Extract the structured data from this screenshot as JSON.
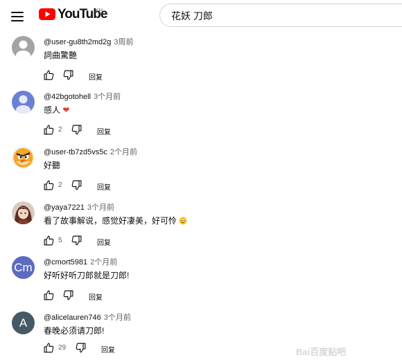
{
  "header": {
    "logo_text": "YouTube",
    "country_code": "KH",
    "search_value": "花妖 刀郎",
    "logo_color": "#ff0000"
  },
  "comments": [
    {
      "author": "@user-gu8th2md2g",
      "time": "3周前",
      "text": "詞曲驚艷",
      "likes": "",
      "avatar": "person-grey"
    },
    {
      "author": "@42bgotohell",
      "time": "3个月前",
      "text": "感人",
      "likes": "2",
      "avatar": "person-blue",
      "emoji": "heart"
    },
    {
      "author": "@user-tb7zd5vs5c",
      "time": "2个月前",
      "text": "好聽",
      "likes": "2",
      "avatar": "angry-bird"
    },
    {
      "author": "@yaya7221",
      "time": "3个月前",
      "text": "看了故事解说，感觉好凄美，好可怜",
      "likes": "5",
      "avatar": "illustration",
      "emoji": "pleading-face"
    },
    {
      "author": "@cmort5981",
      "time": "2个月前",
      "text": "好听好听刀郎就是刀郎!",
      "likes": "",
      "avatar": "letters",
      "avatar_text": "Cm",
      "avatar_color": "#5c6bc0"
    },
    {
      "author": "@alicelauren746",
      "time": "3个月前",
      "text": "春晚必须请刀郎!",
      "likes": "29",
      "avatar": "letters",
      "avatar_text": "A",
      "avatar_color": "#455a64"
    }
  ],
  "reply_label": "回复",
  "watermark": "Bai百度贴吧"
}
